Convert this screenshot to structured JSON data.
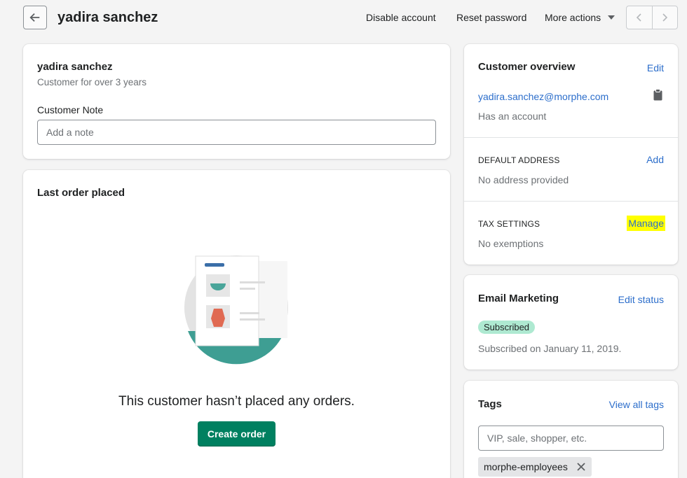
{
  "header": {
    "title": "yadira sanchez",
    "actions": {
      "disable": "Disable account",
      "reset": "Reset password",
      "more": "More actions"
    }
  },
  "customer": {
    "name": "yadira sanchez",
    "since": "Customer for over 3 years",
    "note_label": "Customer Note",
    "note_placeholder": "Add a note",
    "note_value": ""
  },
  "orders": {
    "title": "Last order placed",
    "empty_text": "This customer hasn’t placed any orders.",
    "create_label": "Create order"
  },
  "overview": {
    "title": "Customer overview",
    "edit_label": "Edit",
    "email": "yadira.sanchez@morphe.com",
    "account_status": "Has an account",
    "address_heading": "DEFAULT ADDRESS",
    "address_action": "Add",
    "address_value": "No address provided",
    "tax_heading": "TAX SETTINGS",
    "tax_action": "Manage",
    "tax_value": "No exemptions"
  },
  "email_marketing": {
    "title": "Email Marketing",
    "action": "Edit status",
    "badge": "Subscribed",
    "detail": "Subscribed on January 11, 2019."
  },
  "tags": {
    "title": "Tags",
    "action": "View all tags",
    "placeholder": "VIP, sale, shopper, etc.",
    "items": [
      "morphe-employees"
    ]
  },
  "colors": {
    "primary": "#008060",
    "link": "#2c6ecb",
    "highlight": "#ffff00",
    "badge_bg": "#aee9d1"
  },
  "icons": {
    "back": "arrow-left-icon",
    "prev": "chevron-left-icon",
    "next": "chevron-right-icon",
    "copy": "clipboard-icon",
    "remove_tag": "close-icon"
  }
}
